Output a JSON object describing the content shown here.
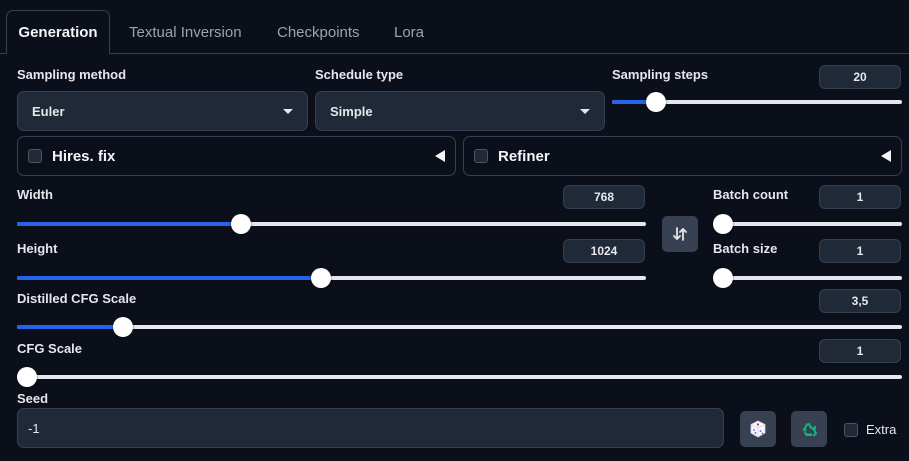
{
  "tabs": [
    {
      "label": "Generation",
      "active": true
    },
    {
      "label": "Textual Inversion"
    },
    {
      "label": "Checkpoints"
    },
    {
      "label": "Lora"
    }
  ],
  "sampling_method": {
    "label": "Sampling method",
    "value": "Euler"
  },
  "schedule_type": {
    "label": "Schedule type",
    "value": "Simple"
  },
  "sampling_steps": {
    "label": "Sampling steps",
    "value": "20",
    "fraction": 0.15
  },
  "hires_fix": {
    "label": "Hires. fix",
    "checked": false
  },
  "refiner": {
    "label": "Refiner",
    "checked": false
  },
  "width": {
    "label": "Width",
    "value": "768",
    "fraction": 0.356
  },
  "height": {
    "label": "Height",
    "value": "1024",
    "fraction": 0.484
  },
  "batch_count": {
    "label": "Batch count",
    "value": "1",
    "fraction": 0.0
  },
  "batch_size": {
    "label": "Batch size",
    "value": "1",
    "fraction": 0.0
  },
  "distilled_cfg": {
    "label": "Distilled CFG Scale",
    "value": "3,5",
    "fraction": 0.12
  },
  "cfg_scale": {
    "label": "CFG Scale",
    "value": "1",
    "fraction": 0.0
  },
  "seed": {
    "label": "Seed",
    "value": "-1"
  },
  "extra": {
    "label": "Extra",
    "checked": false
  },
  "colors": {
    "accent": "#2563eb",
    "background": "#0b0f19",
    "panel": "#1f2937",
    "border": "#374151"
  }
}
